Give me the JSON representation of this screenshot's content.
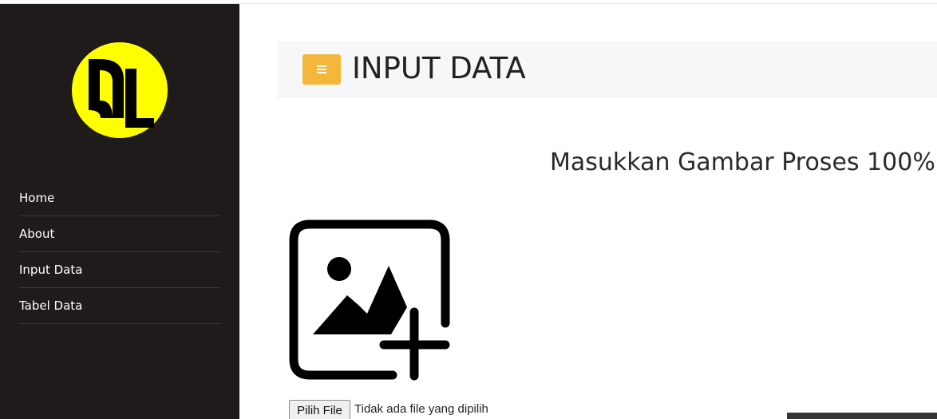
{
  "sidebar": {
    "logo_icon": "pu-logo-icon",
    "items": [
      {
        "label": "Home"
      },
      {
        "label": "About"
      },
      {
        "label": "Input Data"
      },
      {
        "label": "Tabel Data"
      }
    ]
  },
  "header": {
    "menu_icon": "hamburger-icon",
    "title": "INPUT DATA"
  },
  "main": {
    "heading": "Masukkan Gambar Proses 100%",
    "upload_icon": "add-image-icon",
    "file_button_label": "Pilih File",
    "file_status": "Tidak ada file yang dipilih"
  },
  "colors": {
    "sidebar_bg": "#1e1b1a",
    "accent": "#f5b73b",
    "logo_yellow": "#ffff00",
    "header_bg": "#f6f7f8"
  }
}
